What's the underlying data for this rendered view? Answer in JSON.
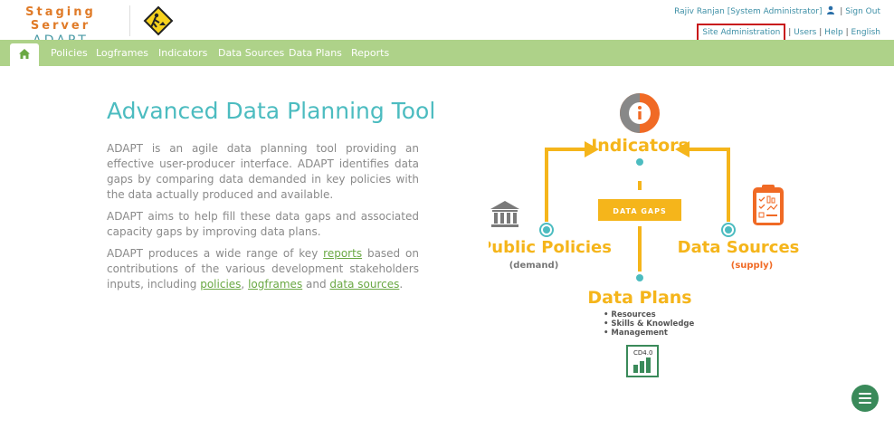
{
  "brand": {
    "line1": "Staging Server",
    "line2": "ADAPT"
  },
  "user": {
    "name": "Rajiv Ranjan [System Administrator]",
    "sign_out": "Sign Out"
  },
  "toplinks": {
    "site_admin": "Site Administration",
    "users": "Users",
    "help": "Help",
    "language": "English",
    "sep": "|"
  },
  "nav": {
    "items": [
      "Policies",
      "Logframes",
      "Indicators",
      "Data Sources",
      "Data Plans",
      "Reports"
    ]
  },
  "main": {
    "title": "Advanced Data Planning Tool",
    "p1": "ADAPT is an agile data planning tool providing an effective user-producer interface. ADAPT identifies data gaps by comparing data demanded in key policies with the data actually produced and available.",
    "p2": "ADAPT aims to help fill these data gaps and associated capacity gaps by improving data plans.",
    "p3_pre": "ADAPT produces a wide range of key ",
    "p3_link1": "reports",
    "p3_mid1": " based on contributions of the various development stakeholders inputs, including ",
    "p3_link2": "policies",
    "p3_mid2": ", ",
    "p3_link3": "logframes",
    "p3_mid3": " and ",
    "p3_link4": "data sources",
    "p3_end": "."
  },
  "diagram": {
    "indicators": "Indicators",
    "data_gaps": "DATA GAPS",
    "public_policies": "Public Policies",
    "demand": "(demand)",
    "data_sources": "Data Sources",
    "supply": "(supply)",
    "data_plans": "Data Plans",
    "bullets": [
      "Resources",
      "Skills & Knowledge",
      "Management"
    ],
    "badge": "CD4.0"
  },
  "colors": {
    "nav": "#aed289",
    "accent": "#4cbcc0",
    "orange": "#f5b51b",
    "green": "#3a8a5a",
    "highlight": "#c8171b"
  }
}
